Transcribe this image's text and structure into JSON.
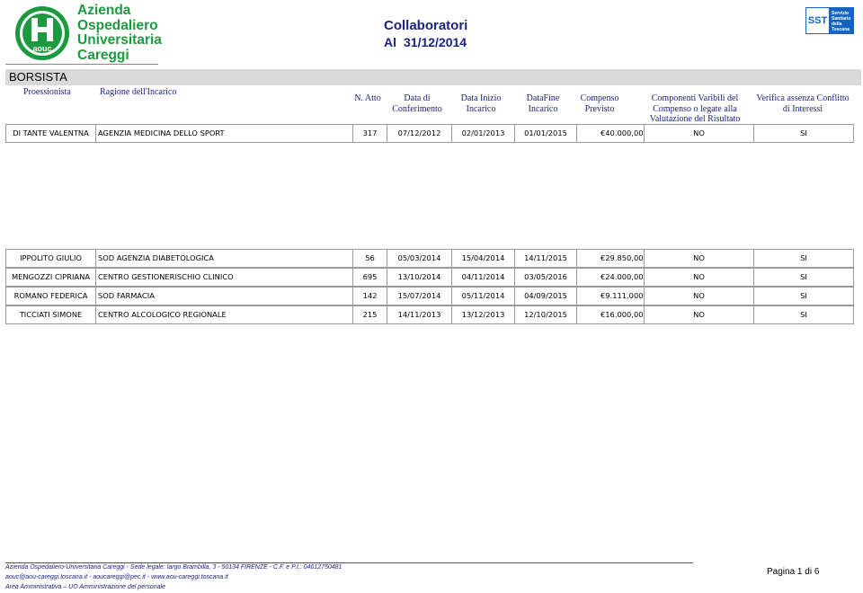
{
  "header": {
    "org_line1": "Azienda",
    "org_line2": "Ospedaliero",
    "org_line3": "Universitaria",
    "org_line4": "Careggi",
    "logo_text": "aouc",
    "title": "Collaboratori",
    "date_prefix": "Al",
    "date": "31/12/2014",
    "sst_logo_text": "SST",
    "sst_line1": "Servizio",
    "sst_line2": "Sanitario",
    "sst_line3": "della",
    "sst_line4": "Toscana"
  },
  "section": {
    "label": "BORSISTA"
  },
  "columns": {
    "professionista": "Proessionista",
    "ragione": "Ragione dell'Incarico",
    "n_atto": "N. Atto",
    "data_conf_1": "Data di",
    "data_conf_2": "Conferimento",
    "data_inizio_1": "Data Inizio",
    "data_inizio_2": "Incarico",
    "data_fine_1": "DataFine",
    "data_fine_2": "Incarico",
    "compenso_1": "Compenso",
    "compenso_2": "Previsto",
    "componenti_1": "Componenti Varibili del",
    "componenti_2": "Compenso o legate alla",
    "componenti_3": "Valutazione del Risultato",
    "verifica_1": "Verifica assenza Conflitto",
    "verifica_2": "di Interessi"
  },
  "rows": [
    {
      "name": "DI TANTE VALENTNA",
      "ragione": "AGENZIA MEDICINA DELLO SPORT",
      "atto": "317",
      "conferimento": "07/12/2012",
      "inizio": "02/01/2013",
      "fine": "01/01/2015",
      "currency": "€",
      "compenso": "40.000,000",
      "componenti": "NO",
      "verifica": "SI"
    },
    {
      "name": "IPPOLITO GIULIO",
      "ragione": "SOD AGENZIA DIABETOLOGICA",
      "atto": "56",
      "conferimento": "05/03/2014",
      "inizio": "15/04/2014",
      "fine": "14/11/2015",
      "currency": "€",
      "compenso": "29.850,000",
      "componenti": "NO",
      "verifica": "SI"
    },
    {
      "name": "MENGOZZI CIPRIANA",
      "ragione": "CENTRO GESTIONERISCHIO CLINICO",
      "atto": "695",
      "conferimento": "13/10/2014",
      "inizio": "04/11/2014",
      "fine": "03/05/2016",
      "currency": "€",
      "compenso": "24.000,000",
      "componenti": "NO",
      "verifica": "SI"
    },
    {
      "name": "ROMANO FEDERICA",
      "ragione": "SOD FARMACIA",
      "atto": "142",
      "conferimento": "15/07/2014",
      "inizio": "05/11/2014",
      "fine": "04/09/2015",
      "currency": "€",
      "compenso": "9.111,000",
      "componenti": "NO",
      "verifica": "SI"
    },
    {
      "name": "TICCIATI SIMONE",
      "ragione": "CENTRO ALCOLOGICO REGIONALE",
      "atto": "215",
      "conferimento": "14/11/2013",
      "inizio": "13/12/2013",
      "fine": "12/10/2015",
      "currency": "€",
      "compenso": "16.000,000",
      "componenti": "NO",
      "verifica": "SI"
    }
  ],
  "footer": {
    "line1": "Azienda Ospedaliero-Universitaria Careggi - Sede legale: largo Brambilla, 3 -  50134  FIRENZE - C.F. e P.I.: 04612750481",
    "line2": "aouc@aou-careggi.toscana.it  -  aoucareggi@pec.it  - www.aou-careggi.toscana.it",
    "line3": "Area Amministrativa – UO Amministrazione del personale",
    "page": "Pagina 1 di 6"
  },
  "colors": {
    "brand_green": "#1c9a3f",
    "title_navy": "#1a237e",
    "sst_blue": "#1565c0"
  },
  "icons": {
    "logo_left": "aouc-logo-icon",
    "logo_right": "sst-logo-icon"
  }
}
